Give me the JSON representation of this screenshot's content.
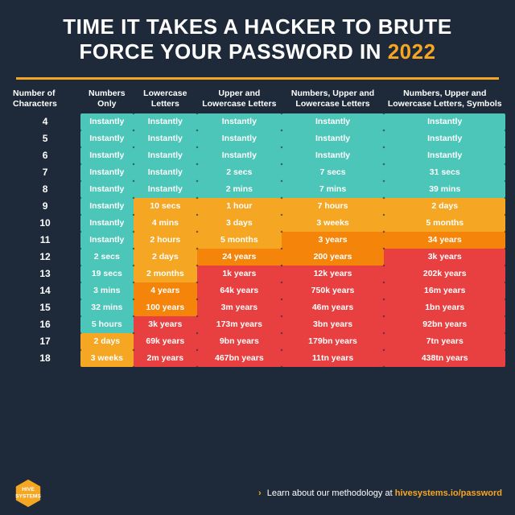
{
  "header": {
    "title_part1": "TIME IT TAKES A HACKER TO BRUTE",
    "title_part2": "FORCE YOUR PASSWORD IN ",
    "year": "2022"
  },
  "columns": [
    "Number of Characters",
    "Numbers Only",
    "Lowercase Letters",
    "Upper and Lowercase Letters",
    "Numbers, Upper and Lowercase Letters",
    "Numbers, Upper and Lowercase Letters, Symbols"
  ],
  "rows": [
    {
      "chars": "4",
      "c1": "Instantly",
      "c2": "Instantly",
      "c3": "Instantly",
      "c4": "Instantly",
      "c5": "Instantly",
      "color1": "#4bc6b9",
      "color2": "#4bc6b9",
      "color3": "#4bc6b9",
      "color4": "#4bc6b9",
      "color5": "#4bc6b9"
    },
    {
      "chars": "5",
      "c1": "Instantly",
      "c2": "Instantly",
      "c3": "Instantly",
      "c4": "Instantly",
      "c5": "Instantly",
      "color1": "#4bc6b9",
      "color2": "#4bc6b9",
      "color3": "#4bc6b9",
      "color4": "#4bc6b9",
      "color5": "#4bc6b9"
    },
    {
      "chars": "6",
      "c1": "Instantly",
      "c2": "Instantly",
      "c3": "Instantly",
      "c4": "Instantly",
      "c5": "Instantly",
      "color1": "#4bc6b9",
      "color2": "#4bc6b9",
      "color3": "#4bc6b9",
      "color4": "#4bc6b9",
      "color5": "#4bc6b9"
    },
    {
      "chars": "7",
      "c1": "Instantly",
      "c2": "Instantly",
      "c3": "2 secs",
      "c4": "7 secs",
      "c5": "31 secs",
      "color1": "#4bc6b9",
      "color2": "#4bc6b9",
      "color3": "#4bc6b9",
      "color4": "#4bc6b9",
      "color5": "#4bc6b9"
    },
    {
      "chars": "8",
      "c1": "Instantly",
      "c2": "Instantly",
      "c3": "2 mins",
      "c4": "7 mins",
      "c5": "39 mins",
      "color1": "#4bc6b9",
      "color2": "#4bc6b9",
      "color3": "#4bc6b9",
      "color4": "#4bc6b9",
      "color5": "#4bc6b9"
    },
    {
      "chars": "9",
      "c1": "Instantly",
      "c2": "10 secs",
      "c3": "1 hour",
      "c4": "7 hours",
      "c5": "2 days",
      "color1": "#4bc6b9",
      "color2": "#f5a623",
      "color3": "#f5a623",
      "color4": "#f5a623",
      "color5": "#f5a623"
    },
    {
      "chars": "10",
      "c1": "Instantly",
      "c2": "4 mins",
      "c3": "3 days",
      "c4": "3 weeks",
      "c5": "5 months",
      "color1": "#4bc6b9",
      "color2": "#f5a623",
      "color3": "#f5a623",
      "color4": "#f5a623",
      "color5": "#f5a623"
    },
    {
      "chars": "11",
      "c1": "Instantly",
      "c2": "2 hours",
      "c3": "5 months",
      "c4": "3 years",
      "c5": "34 years",
      "color1": "#4bc6b9",
      "color2": "#f5a623",
      "color3": "#f5a623",
      "color4": "#f5850a",
      "color5": "#f5850a"
    },
    {
      "chars": "12",
      "c1": "2 secs",
      "c2": "2 days",
      "c3": "24 years",
      "c4": "200 years",
      "c5": "3k years",
      "color1": "#4bc6b9",
      "color2": "#f5a623",
      "color3": "#f5850a",
      "color4": "#f5850a",
      "color5": "#e84040"
    },
    {
      "chars": "13",
      "c1": "19 secs",
      "c2": "2 months",
      "c3": "1k years",
      "c4": "12k years",
      "c5": "202k years",
      "color1": "#4bc6b9",
      "color2": "#f5a623",
      "color3": "#e84040",
      "color4": "#e84040",
      "color5": "#e84040"
    },
    {
      "chars": "14",
      "c1": "3 mins",
      "c2": "4 years",
      "c3": "64k years",
      "c4": "750k years",
      "c5": "16m years",
      "color1": "#4bc6b9",
      "color2": "#f5850a",
      "color3": "#e84040",
      "color4": "#e84040",
      "color5": "#e84040"
    },
    {
      "chars": "15",
      "c1": "32 mins",
      "c2": "100 years",
      "c3": "3m years",
      "c4": "46m years",
      "c5": "1bn years",
      "color1": "#4bc6b9",
      "color2": "#f5850a",
      "color3": "#e84040",
      "color4": "#e84040",
      "color5": "#e84040"
    },
    {
      "chars": "16",
      "c1": "5 hours",
      "c2": "3k years",
      "c3": "173m years",
      "c4": "3bn years",
      "c5": "92bn years",
      "color1": "#4bc6b9",
      "color2": "#e84040",
      "color3": "#e84040",
      "color4": "#e84040",
      "color5": "#e84040"
    },
    {
      "chars": "17",
      "c1": "2 days",
      "c2": "69k years",
      "c3": "9bn years",
      "c4": "179bn years",
      "c5": "7tn years",
      "color1": "#f5a623",
      "color2": "#e84040",
      "color3": "#e84040",
      "color4": "#e84040",
      "color5": "#e84040"
    },
    {
      "chars": "18",
      "c1": "3 weeks",
      "c2": "2m years",
      "c3": "467bn years",
      "c4": "11tn years",
      "c5": "438tn years",
      "color1": "#f5a623",
      "color2": "#e84040",
      "color3": "#e84040",
      "color4": "#e84040",
      "color5": "#e84040"
    }
  ],
  "footer": {
    "logo_name": "HIVE\nSYSTEMS",
    "learn_text": "Learn about our methodology at ",
    "link_url": "hivesystems.io/password",
    "arrow": "›"
  }
}
